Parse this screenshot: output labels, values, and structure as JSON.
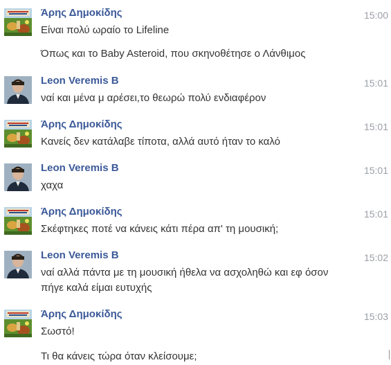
{
  "messages": [
    {
      "sender": "Άρης Δημοκίδης",
      "time": "15:00",
      "avatar": "aris-avatar",
      "lines": [
        "Είναι πολύ ωραίο το Lifeline",
        "Όπως και το Baby Asteroid, που σκηνοθέτησε ο Λάνθιμος"
      ]
    },
    {
      "sender": "Leon Veremis B",
      "time": "15:01",
      "avatar": "leon-avatar",
      "lines": [
        "ναί και μένα μ αρέσει,το θεωρώ πολύ ενδιαφέρον"
      ]
    },
    {
      "sender": "Άρης Δημοκίδης",
      "time": "15:01",
      "avatar": "aris-avatar",
      "lines": [
        "Κανείς δεν κατάλαβε τίποτα, αλλά αυτό ήταν το καλό"
      ]
    },
    {
      "sender": "Leon Veremis B",
      "time": "15:01",
      "avatar": "leon-avatar",
      "lines": [
        "χαχα"
      ]
    },
    {
      "sender": "Άρης Δημοκίδης",
      "time": "15:01",
      "avatar": "aris-avatar",
      "lines": [
        "Σκέφτηκες ποτέ να κάνεις κάτι πέρα απ' τη μουσική;"
      ]
    },
    {
      "sender": "Leon Veremis B",
      "time": "15:02",
      "avatar": "leon-avatar",
      "lines": [
        "ναί αλλά πάντα με τη μουσική ήθελα να ασχοληθώ και εφ όσον",
        "πήγε καλά είμαι ευτυχής"
      ]
    },
    {
      "sender": "Άρης Δημοκίδης",
      "time": "15:03",
      "avatar": "aris-avatar",
      "lines": [
        "Σωστό!",
        "Τι θα κάνεις τώρα όταν κλείσουμε;"
      ]
    }
  ]
}
